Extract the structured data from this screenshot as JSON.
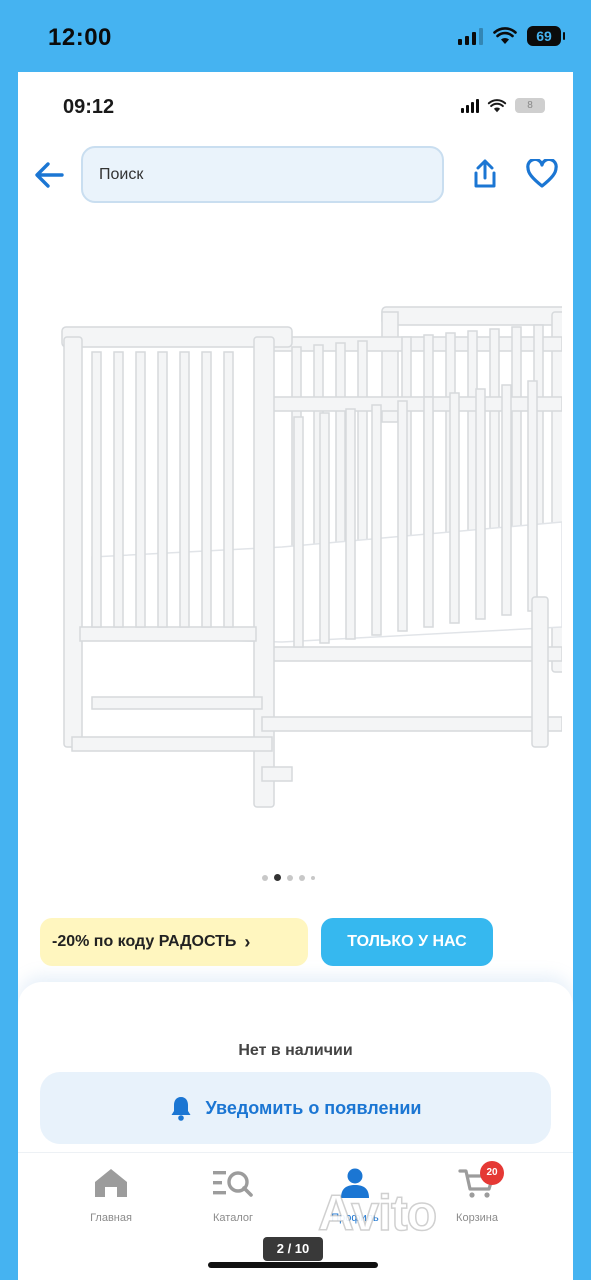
{
  "outer_status": {
    "time": "12:00",
    "battery": "69"
  },
  "inner_status": {
    "time": "09:12",
    "battery": "8"
  },
  "appbar": {
    "search_placeholder": "Поиск",
    "back_icon": "arrow-left-icon",
    "share_icon": "share-icon",
    "favorite_icon": "heart-icon"
  },
  "gallery": {
    "dots_total": 5,
    "active_dot": 2,
    "counter": "2 / 10",
    "image_subject": "white wooden baby crib with mattress"
  },
  "promo": {
    "label": "-20% по коду РАДОСТЬ",
    "chevron": "›"
  },
  "exclusive_label": "ТОЛЬКО У НАС",
  "availability": {
    "status": "Нет в наличии",
    "notify_label": "Уведомить о появлении",
    "notify_icon": "bell-icon"
  },
  "tabbar": {
    "items": [
      {
        "label": "Главная",
        "icon": "home-icon"
      },
      {
        "label": "Каталог",
        "icon": "catalog-search-icon"
      },
      {
        "label": "Профиль",
        "icon": "profile-icon",
        "active": true
      },
      {
        "label": "Корзина",
        "icon": "cart-icon",
        "badge": "20"
      }
    ]
  },
  "watermark": "Avito",
  "colors": {
    "accent": "#1b76d3",
    "outer_bg": "#45b3f1",
    "promo_bg": "#fff6bf",
    "exclusive_bg": "#36b8ef",
    "badge": "#e53935"
  }
}
